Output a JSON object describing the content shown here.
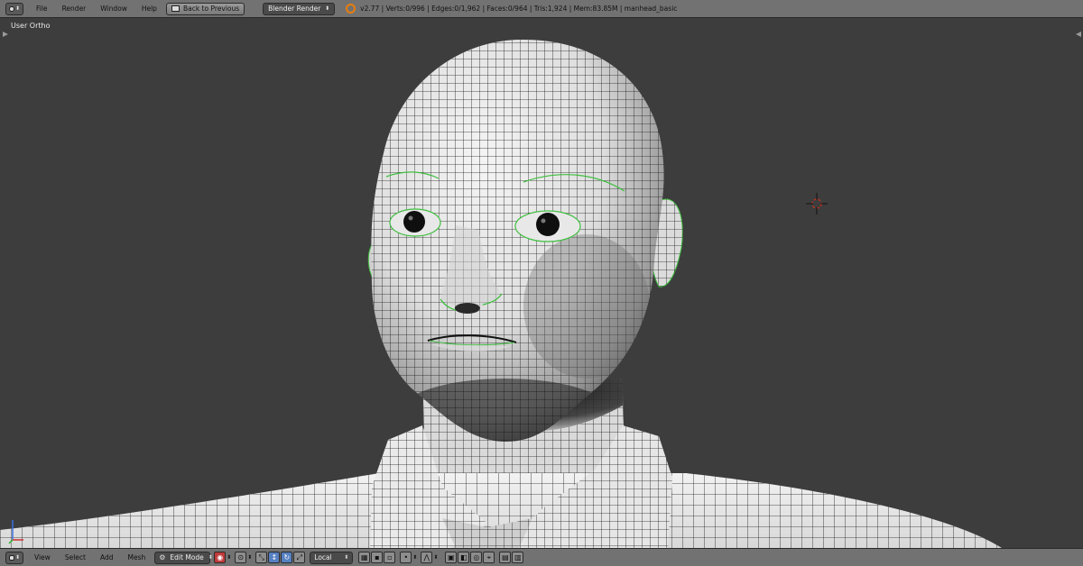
{
  "topbar": {
    "editor_icon": "info-editor-icon",
    "menus": [
      "File",
      "Render",
      "Window",
      "Help"
    ],
    "back_button": "Back to Previous",
    "render_engine": "Blender Render",
    "stats": "v2.77 | Verts:0/996 | Edges:0/1,962 | Faces:0/964 | Tris:1,924 | Mem:83.85M | manhead_basic"
  },
  "viewport": {
    "view_label": "User Ortho",
    "background_color": "#3d3d3d",
    "wire_color": "#1a1a1a",
    "seam_color": "#3fbf3f"
  },
  "bottombar": {
    "menus": [
      "View",
      "Select",
      "Add",
      "Mesh"
    ],
    "mode": "Edit Mode",
    "orientation": "Local",
    "icons": [
      "view3d-editor-icon",
      "mode-icon",
      "viewport-shading-icon",
      "pivot-icon",
      "manipulator-icon",
      "translate-icon",
      "rotate-icon",
      "scale-icon",
      "layers-icon",
      "vertex-select-icon",
      "edge-select-icon",
      "face-select-icon",
      "occlude-icon",
      "proportional-icon",
      "snap-icon",
      "render-icon"
    ]
  }
}
